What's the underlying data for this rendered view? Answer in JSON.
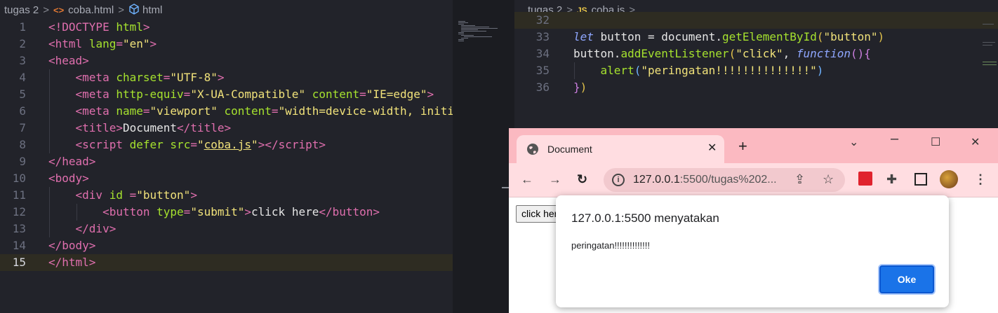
{
  "left_editor": {
    "breadcrumb": {
      "folder": "tugas 2",
      "file": "coba.html",
      "symbol": "html"
    },
    "active_line": "15",
    "lines": [
      {
        "n": "1"
      },
      {
        "n": "2"
      },
      {
        "n": "3"
      },
      {
        "n": "4"
      },
      {
        "n": "5"
      },
      {
        "n": "6"
      },
      {
        "n": "7"
      },
      {
        "n": "8"
      },
      {
        "n": "9"
      },
      {
        "n": "10"
      },
      {
        "n": "11"
      },
      {
        "n": "12"
      },
      {
        "n": "13"
      },
      {
        "n": "14"
      },
      {
        "n": "15"
      }
    ]
  },
  "right_editor": {
    "breadcrumb": {
      "folder": "tugas 2",
      "file_icon": "JS",
      "file": "coba.js",
      "more": "..."
    },
    "lines": [
      "32",
      "33",
      "34",
      "35",
      "36"
    ]
  },
  "browser": {
    "tab_title": "Document",
    "url_host": "127.0.0.1",
    "url_rest": ":5500/tugas%202...",
    "page_button_label": "click here",
    "icons": [
      "globe-icon",
      "close-icon",
      "new-tab-icon",
      "chevron-down-icon",
      "minimize-icon",
      "maximize-icon",
      "window-close-icon",
      "back-icon",
      "forward-icon",
      "reload-icon",
      "info-icon",
      "share-icon",
      "star-icon",
      "extension-red-icon",
      "puzzle-icon",
      "sidepanel-icon",
      "avatar",
      "menu-icon"
    ]
  },
  "dialog": {
    "title": "127.0.0.1:5500 menyatakan",
    "message": "peringatan!!!!!!!!!!!!!!",
    "ok_label": "Oke",
    "accent": "#1a73e8"
  },
  "colors": {
    "editor_bg": "#22232a",
    "tag": "#e06fae",
    "attr": "#a6e22e",
    "string": "#f1e27a",
    "titlebar": "#fbb9c1"
  }
}
